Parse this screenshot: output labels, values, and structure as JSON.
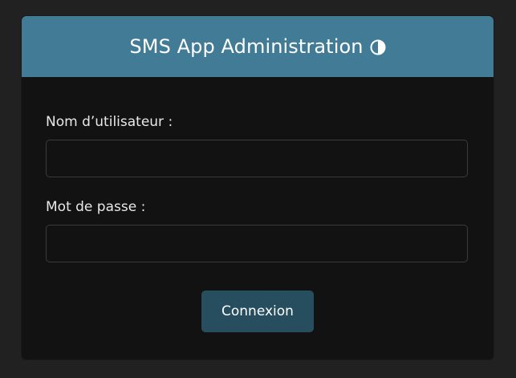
{
  "header": {
    "title": "SMS App Administration",
    "theme_icon": "contrast-half-circle-icon"
  },
  "form": {
    "username_label": "Nom d’utilisateur :",
    "username_value": "",
    "password_label": "Mot de passe :",
    "password_value": "",
    "submit_label": "Connexion"
  },
  "colors": {
    "background": "#212121",
    "card": "#121212",
    "header": "#417b96",
    "button": "#264e5f",
    "text": "#e8e8e8"
  }
}
